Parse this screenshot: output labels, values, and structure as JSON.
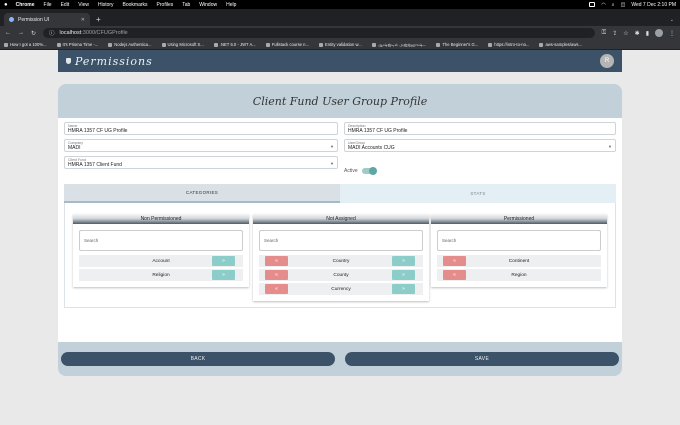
{
  "os_menu": {
    "app": "Chrome",
    "items": [
      "File",
      "Edit",
      "View",
      "History",
      "Bookmarks",
      "Profiles",
      "Tab",
      "Window",
      "Help"
    ],
    "clock": "Wed 7 Dec 2:10 PM"
  },
  "browser": {
    "tab_title": "Permission UI",
    "url_host": "localhost",
    "url_path": ":3000/CFUGProfile",
    "bookmarks": [
      "How I got a 100%...",
      "It's Prisma Time -...",
      "Nodejs Authentica...",
      "Using Microsoft S...",
      ".NET 6.0 - JWT A...",
      "Fullstack course n...",
      "Entity validation w...",
      "ஆஷ்ஜ்டில் அஜ்ஜ்ஹுஷ்...",
      "The Beginner's G...",
      "https://intro-to-no...",
      "aws-samples/aws..."
    ]
  },
  "app": {
    "brand": "Permissions",
    "user_initial": "R"
  },
  "page": {
    "title": "Client Fund User Group Profile",
    "name": {
      "label": "Name",
      "value": "HMRA 1357 CF UG Profile"
    },
    "description": {
      "label": "Description",
      "value": "HMRA 1357 CF UG Profile"
    },
    "company": {
      "label": "Company",
      "value": "MADI"
    },
    "user_group": {
      "label": "UserGroup",
      "value": "MADI Accounts CUG"
    },
    "client_fund": {
      "label": "Client Fund",
      "value": "HMRA 1357 Client Fund"
    },
    "active_label": "Active",
    "active_on": true,
    "tabs": [
      "CATEGORIES",
      "STATS"
    ],
    "panels": {
      "non_permissioned": {
        "title": "Non Permissioned",
        "search_placeholder": "Search",
        "items": [
          "Account",
          "Religion"
        ]
      },
      "not_assigned": {
        "title": "Not Assigned",
        "search_placeholder": "Search",
        "items": [
          "Country",
          "County",
          "Currency"
        ]
      },
      "permissioned": {
        "title": "Permissioned",
        "search_placeholder": "Search",
        "items": [
          "Continent",
          "Region"
        ]
      }
    },
    "back_label": "BACK",
    "save_label": "SAVE"
  },
  "icons": {
    "move_right": "»",
    "move_left": "«"
  },
  "colors": {
    "header": "#3c5268",
    "add_button": "#8ccdca",
    "remove_button": "#e58d8d",
    "card_bg": "#c2d0da"
  }
}
